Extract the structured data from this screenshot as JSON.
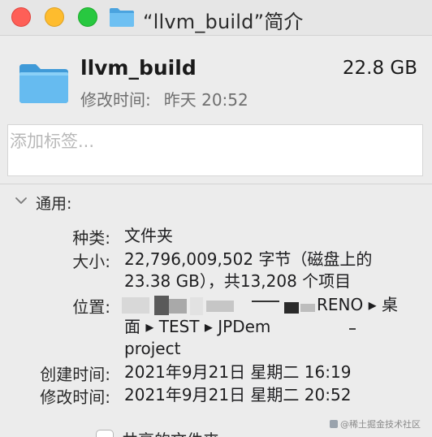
{
  "window": {
    "title": "“llvm_build”简介"
  },
  "header": {
    "name": "llvm_build",
    "size": "22.8 GB",
    "modified_label": "修改时间:",
    "modified_value": "昨天 20:52"
  },
  "tags": {
    "placeholder": "添加标签..."
  },
  "general": {
    "title": "通用:",
    "kind_label": "种类:",
    "kind_value": "文件夹",
    "size_label": "大小:",
    "size_line1": "22,796,009,502 字节（磁盘上的",
    "size_line2": "23.38 GB），共13,208 个项目",
    "where_label": "位置:",
    "where_line1": "RENO ▸ 桌",
    "where_line2_a": "面 ▸ TEST ▸ JPDem",
    "where_line3": "project",
    "created_label": "创建时间:",
    "created_value": "2021年9月21日 星期二 16:19",
    "modified_label": "修改时间:",
    "modified_value": "2021年9月21日 星期二 20:52"
  },
  "sharing": {
    "shared_folder_label": "共享的文件夹"
  },
  "watermark": "@稀土掘金技术社区",
  "icons": {
    "folder": "folder-icon",
    "chevron": "chevron-down-icon"
  },
  "colors": {
    "close": "#fe5f57",
    "minimize": "#febc2e",
    "maximize": "#28c840",
    "folder": "#5ab1ea"
  }
}
